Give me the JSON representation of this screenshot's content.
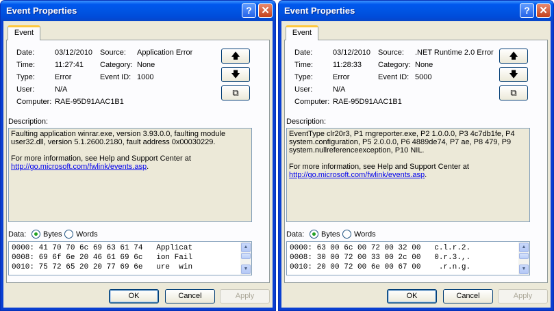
{
  "windows": [
    {
      "title": "Event Properties",
      "title_help": "?",
      "title_close": "✕",
      "tab_label": "Event",
      "date_label": "Date:",
      "date": "03/12/2010",
      "time_label": "Time:",
      "time": "11:27:41",
      "type_label": "Type:",
      "type": "Error",
      "user_label": "User:",
      "user": "N/A",
      "computer_label": "Computer:",
      "computer": "RAE-95D91AAC1B1",
      "source_label": "Source:",
      "source": "Application Error",
      "category_label": "Category:",
      "category": "None",
      "eventid_label": "Event ID:",
      "eventid": "1000",
      "up_icon": "🡅",
      "down_icon": "🡇",
      "copy_icon": "⧉",
      "description_label": "Description:",
      "description_lines": [
        "Faulting application winrar.exe, version 3.93.0.0, faulting module",
        "user32.dll, version 5.1.2600.2180, fault address 0x00030229."
      ],
      "help_text": "For more information, see Help and Support Center at",
      "help_link": "http://go.microsoft.com/fwlink/events.asp",
      "help_link_suffix": ".",
      "data_label": "Data:",
      "bytes_label": "Bytes",
      "words_label": "Words",
      "data_lines": [
        "0000: 41 70 70 6c 69 63 61 74   Applicat",
        "0008: 69 6f 6e 20 46 61 69 6c   ion Fail",
        "0010: 75 72 65 20 20 77 69 6e   ure  win"
      ],
      "ok_label": "OK",
      "cancel_label": "Cancel",
      "apply_label": "Apply"
    },
    {
      "title": "Event Properties",
      "title_help": "?",
      "title_close": "✕",
      "tab_label": "Event",
      "date_label": "Date:",
      "date": "03/12/2010",
      "time_label": "Time:",
      "time": "11:28:33",
      "type_label": "Type:",
      "type": "Error",
      "user_label": "User:",
      "user": "N/A",
      "computer_label": "Computer:",
      "computer": "RAE-95D91AAC1B1",
      "source_label": "Source:",
      "source": ".NET Runtime 2.0 Error",
      "category_label": "Category:",
      "category": "None",
      "eventid_label": "Event ID:",
      "eventid": "5000",
      "up_icon": "🡅",
      "down_icon": "🡇",
      "copy_icon": "⧉",
      "description_label": "Description:",
      "description_lines": [
        "EventType clr20r3, P1 rngreporter.exe, P2 1.0.0.0, P3 4c7db1fe, P4",
        "system.configuration, P5 2.0.0.0, P6 4889de74, P7 ae, P8 479, P9",
        "system.nullreferenceexception, P10 NIL."
      ],
      "help_text": "For more information, see Help and Support Center at",
      "help_link": "http://go.microsoft.com/fwlink/events.asp",
      "help_link_suffix": ".",
      "data_label": "Data:",
      "bytes_label": "Bytes",
      "words_label": "Words",
      "data_lines": [
        "0000: 63 00 6c 00 72 00 32 00   c.l.r.2.",
        "0008: 30 00 72 00 33 00 2c 00   0.r.3.,.",
        "0010: 20 00 72 00 6e 00 67 00    .r.n.g."
      ],
      "ok_label": "OK",
      "cancel_label": "Cancel",
      "apply_label": "Apply"
    }
  ]
}
